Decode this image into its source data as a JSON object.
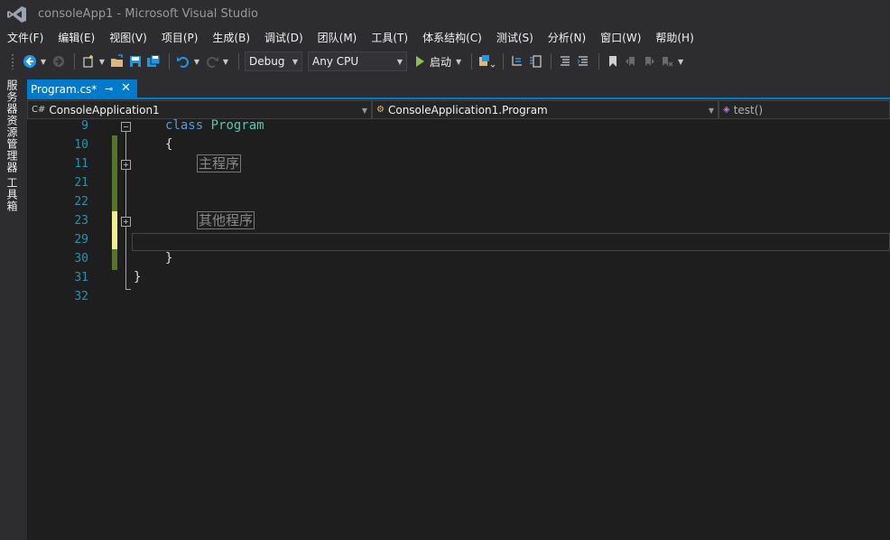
{
  "window": {
    "title": "consoleApp1 - Microsoft Visual Studio"
  },
  "menu": [
    {
      "label": "文件(F)"
    },
    {
      "label": "编辑(E)"
    },
    {
      "label": "视图(V)"
    },
    {
      "label": "项目(P)"
    },
    {
      "label": "生成(B)"
    },
    {
      "label": "调试(D)"
    },
    {
      "label": "团队(M)"
    },
    {
      "label": "工具(T)"
    },
    {
      "label": "体系结构(C)"
    },
    {
      "label": "测试(S)"
    },
    {
      "label": "分析(N)"
    },
    {
      "label": "窗口(W)"
    },
    {
      "label": "帮助(H)"
    }
  ],
  "toolbar": {
    "config": "Debug",
    "platform": "Any CPU",
    "start_label": "启动"
  },
  "side_tabs": {
    "server_explorer": "服务器资源管理器",
    "toolbox": "工具箱"
  },
  "document_tab": {
    "name": "Program.cs*"
  },
  "navbar": {
    "project": "ConsoleApplication1",
    "type": "ConsoleApplication1.Program",
    "member": "test()"
  },
  "editor": {
    "lines": [
      {
        "num": "9"
      },
      {
        "num": "10"
      },
      {
        "num": "11"
      },
      {
        "num": "21"
      },
      {
        "num": "22"
      },
      {
        "num": "23"
      },
      {
        "num": "29"
      },
      {
        "num": "30"
      },
      {
        "num": "31"
      },
      {
        "num": "32"
      }
    ],
    "kw_class": "class",
    "type_program": "Program",
    "brace_open": "{",
    "brace_close": "}",
    "region_main": "主程序",
    "region_other": "其他程序"
  },
  "colors": {
    "accent": "#007acc",
    "saved_change": "#57742b",
    "unsaved_change": "#efef91"
  }
}
